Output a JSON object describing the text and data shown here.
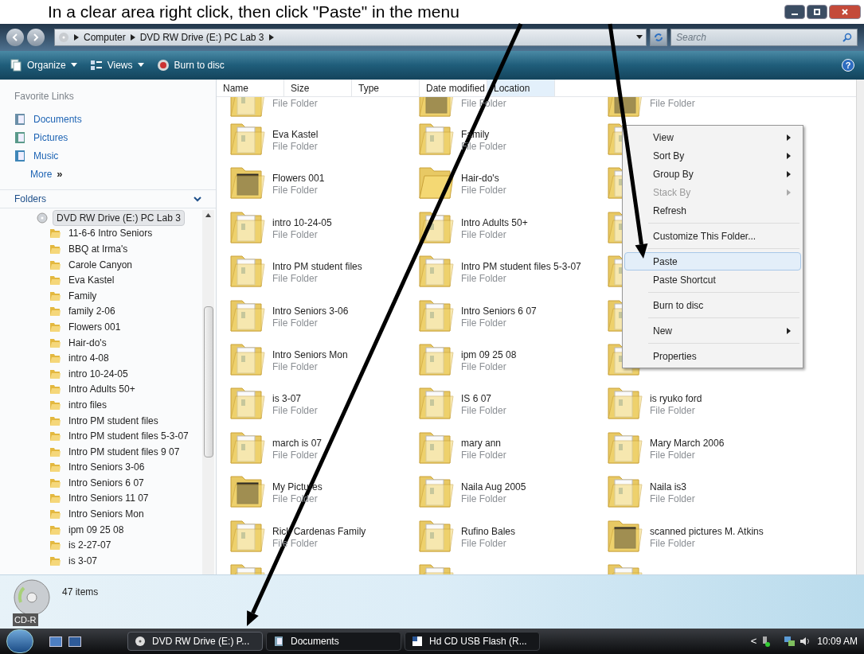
{
  "instruction": "In a clear area right click, then click \"Paste\" in the menu",
  "address_bar": {
    "crumbs": [
      "Computer",
      "DVD RW Drive (E:) PC Lab 3"
    ],
    "search": {
      "placeholder": "Search"
    }
  },
  "toolbar": [
    {
      "label": "Organize",
      "kind": "organize",
      "menu": true
    },
    {
      "label": "Views",
      "kind": "views",
      "menu": true
    },
    {
      "label": "Burn to disc",
      "kind": "burn",
      "menu": false
    }
  ],
  "help_glyph": "?",
  "favorite_links": {
    "title": "Favorite Links",
    "items": [
      {
        "label": "Documents",
        "kind": "documents"
      },
      {
        "label": "Pictures",
        "kind": "pictures"
      },
      {
        "label": "Music",
        "kind": "music"
      }
    ],
    "more": "More",
    "more_glyph": "»"
  },
  "folders": {
    "title": "Folders",
    "tree": [
      {
        "label": "DVD RW Drive (E:) PC Lab 3",
        "selected": true,
        "children": [
          {
            "label": "11-6-6 Intro Seniors",
            "selected": false
          },
          {
            "label": "BBQ at Irma's",
            "selected": false
          },
          {
            "label": "Carole Canyon",
            "selected": false
          },
          {
            "label": "Eva Kastel",
            "selected": false
          },
          {
            "label": "Family",
            "selected": false
          },
          {
            "label": "family 2-06",
            "selected": false
          },
          {
            "label": "Flowers 001",
            "selected": false
          },
          {
            "label": "Hair-do's",
            "selected": false
          },
          {
            "label": "intro 4-08",
            "selected": false
          },
          {
            "label": "intro 10-24-05",
            "selected": false
          },
          {
            "label": "Intro Adults 50+",
            "selected": false
          },
          {
            "label": "intro files",
            "selected": false
          },
          {
            "label": "Intro PM student files",
            "selected": false
          },
          {
            "label": "Intro PM student files 5-3-07",
            "selected": false
          },
          {
            "label": "Intro PM student files  9 07",
            "selected": false
          },
          {
            "label": "Intro Seniors 3-06",
            "selected": false
          },
          {
            "label": "Intro Seniors 6 07",
            "selected": false
          },
          {
            "label": "Intro Seniors 11 07",
            "selected": false
          },
          {
            "label": "Intro Seniors Mon",
            "selected": false
          },
          {
            "label": "ipm 09 25 08",
            "selected": false
          },
          {
            "label": "is 2-27-07",
            "selected": false
          },
          {
            "label": "is 3-07",
            "selected": false
          }
        ]
      }
    ]
  },
  "columns": [
    {
      "label": "Name",
      "sorted": false
    },
    {
      "label": "Size",
      "sorted": false
    },
    {
      "label": "Type",
      "sorted": false
    },
    {
      "label": "Date modified",
      "sorted": false
    },
    {
      "label": "Location",
      "sorted": true
    }
  ],
  "files": [
    [
      {
        "kind": "folder",
        "type": "File Folder"
      },
      {
        "kind": "photo-folder",
        "type": "File Folder"
      },
      {
        "kind": "photo-folder",
        "type": "File Folder"
      }
    ],
    [
      {
        "kind": "folder",
        "name": "Eva Kastel",
        "type": "File Folder"
      },
      {
        "kind": "folder",
        "name": "Family",
        "type": "File Folder"
      },
      {
        "kind": "folder"
      }
    ],
    [
      {
        "kind": "photo-folder",
        "name": "Flowers 001",
        "type": "File Folder"
      },
      {
        "kind": "empty-folder",
        "name": "Hair-do's",
        "type": "File Folder"
      },
      {
        "kind": "folder"
      }
    ],
    [
      {
        "kind": "folder",
        "name": "intro 10-24-05",
        "type": "File Folder"
      },
      {
        "kind": "folder",
        "name": "Intro Adults 50+",
        "type": "File Folder"
      },
      {
        "kind": "folder"
      }
    ],
    [
      {
        "kind": "folder",
        "name": "Intro PM student files",
        "type": "File Folder"
      },
      {
        "kind": "folder",
        "name": "Intro PM student files 5-3-07",
        "type": "File Folder"
      },
      {
        "kind": "folder"
      }
    ],
    [
      {
        "kind": "folder",
        "name": "Intro Seniors 3-06",
        "type": "File Folder"
      },
      {
        "kind": "folder",
        "name": "Intro Seniors 6 07",
        "type": "File Folder"
      },
      {
        "kind": "folder"
      }
    ],
    [
      {
        "kind": "folder",
        "name": "Intro Seniors Mon",
        "type": "File Folder"
      },
      {
        "kind": "folder",
        "name": "ipm 09 25 08",
        "type": "File Folder"
      },
      {
        "kind": "folder"
      }
    ],
    [
      {
        "kind": "folder",
        "name": "is 3-07",
        "type": "File Folder"
      },
      {
        "kind": "folder",
        "name": "IS 6 07",
        "type": "File Folder"
      },
      {
        "kind": "folder",
        "name": "is ryuko  ford",
        "type": "File Folder"
      }
    ],
    [
      {
        "kind": "folder",
        "name": "march is 07",
        "type": "File Folder"
      },
      {
        "kind": "folder",
        "name": "mary ann",
        "type": "File Folder"
      },
      {
        "kind": "folder",
        "name": "Mary March 2006",
        "type": "File Folder"
      }
    ],
    [
      {
        "kind": "photo-folder",
        "name": "My Pictures",
        "type": "File Folder"
      },
      {
        "kind": "folder",
        "name": "Naila Aug 2005",
        "type": "File Folder"
      },
      {
        "kind": "folder",
        "name": "Naila is3",
        "type": "File Folder"
      }
    ],
    [
      {
        "kind": "folder",
        "name": "Rick Cardenas Family",
        "type": "File Folder"
      },
      {
        "kind": "folder",
        "name": "Rufino Bales",
        "type": "File Folder"
      },
      {
        "kind": "photo-folder",
        "name": "scanned pictures M. Atkins",
        "type": "File Folder"
      }
    ],
    [
      {
        "kind": "folder"
      },
      {
        "kind": "folder"
      },
      {
        "kind": "folder"
      }
    ]
  ],
  "context_menu": [
    {
      "kind": "item",
      "label": "View",
      "submenu": true,
      "disabled": false,
      "selected": false
    },
    {
      "kind": "item",
      "label": "Sort By",
      "submenu": true,
      "disabled": false,
      "selected": false
    },
    {
      "kind": "item",
      "label": "Group By",
      "submenu": true,
      "disabled": false,
      "selected": false
    },
    {
      "kind": "item",
      "label": "Stack By",
      "submenu": true,
      "disabled": true,
      "selected": false
    },
    {
      "kind": "item",
      "label": "Refresh",
      "submenu": false,
      "disabled": false,
      "selected": false
    },
    {
      "kind": "separator"
    },
    {
      "kind": "item",
      "label": "Customize This Folder...",
      "submenu": false,
      "disabled": false,
      "selected": false
    },
    {
      "kind": "separator"
    },
    {
      "kind": "item",
      "label": "Paste",
      "submenu": false,
      "disabled": false,
      "selected": true
    },
    {
      "kind": "item",
      "label": "Paste Shortcut",
      "submenu": false,
      "disabled": false,
      "selected": false
    },
    {
      "kind": "separator"
    },
    {
      "kind": "item",
      "label": "Burn to disc",
      "submenu": false,
      "disabled": false,
      "selected": false
    },
    {
      "kind": "separator"
    },
    {
      "kind": "item",
      "label": "New",
      "submenu": true,
      "disabled": false,
      "selected": false
    },
    {
      "kind": "separator"
    },
    {
      "kind": "item",
      "label": "Properties",
      "submenu": false,
      "disabled": false,
      "selected": false
    }
  ],
  "details": {
    "count": "47 items",
    "drive_label": "CD-R"
  },
  "taskbar": {
    "tasks": [
      {
        "label": "DVD RW Drive (E:) P...",
        "kind": "drive",
        "selected": true
      },
      {
        "label": "Documents",
        "kind": "documents",
        "selected": false
      },
      {
        "label": "Hd CD USB Flash (R...",
        "kind": "word",
        "selected": false
      }
    ],
    "tray_glyph": "<",
    "clock": "10:09 AM"
  }
}
